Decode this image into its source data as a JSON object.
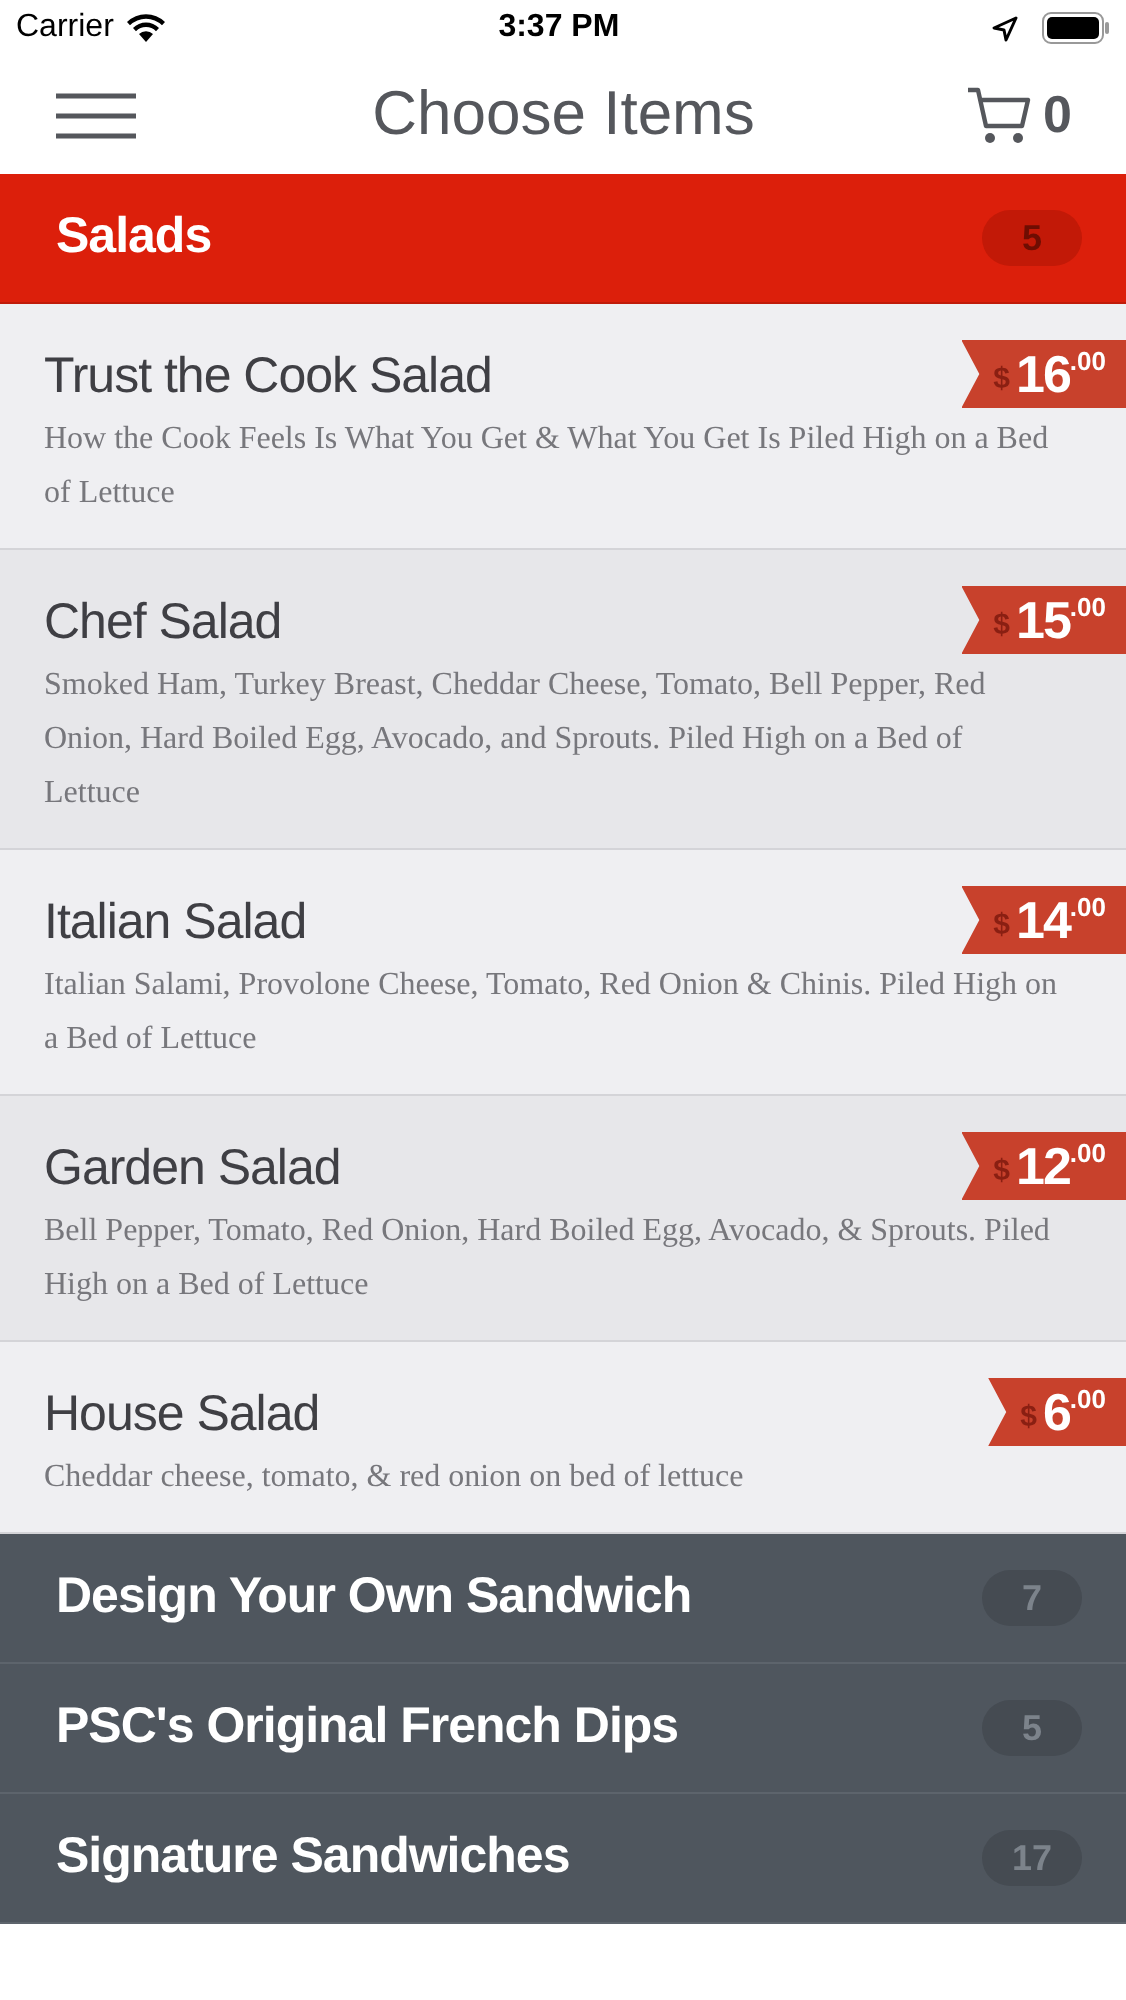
{
  "status_bar": {
    "carrier": "Carrier",
    "time": "3:37 PM"
  },
  "nav": {
    "title": "Choose Items",
    "cart_count": "0"
  },
  "categories": [
    {
      "name": "Salads",
      "count": "5",
      "expanded": true,
      "items": [
        {
          "name": "Trust the Cook Salad",
          "description": "How the Cook Feels Is What You Get & What You Get Is Piled High on a Bed of Lettuce",
          "currency": "$",
          "amount": "16",
          "cents": ".00"
        },
        {
          "name": "Chef Salad",
          "description": "Smoked Ham, Turkey Breast, Cheddar Cheese, Tomato, Bell Pepper, Red Onion, Hard Boiled Egg, Avocado, and Sprouts.  Piled High on a Bed of Lettuce",
          "currency": "$",
          "amount": "15",
          "cents": ".00"
        },
        {
          "name": "Italian Salad",
          "description": "Italian Salami, Provolone Cheese, Tomato, Red Onion & Chinis.  Piled High on a Bed of Lettuce",
          "currency": "$",
          "amount": "14",
          "cents": ".00"
        },
        {
          "name": "Garden Salad",
          "description": "Bell Pepper, Tomato, Red Onion, Hard Boiled Egg, Avocado, & Sprouts. Piled High on a Bed of Lettuce",
          "currency": "$",
          "amount": "12",
          "cents": ".00"
        },
        {
          "name": "House Salad",
          "description": "Cheddar cheese, tomato, & red onion on bed of lettuce",
          "currency": "$",
          "amount": "6",
          "cents": ".00"
        }
      ]
    },
    {
      "name": "Design Your Own Sandwich",
      "count": "7",
      "expanded": false
    },
    {
      "name": "PSC's Original French Dips",
      "count": "5",
      "expanded": false
    },
    {
      "name": "Signature Sandwiches",
      "count": "17",
      "expanded": false
    }
  ]
}
